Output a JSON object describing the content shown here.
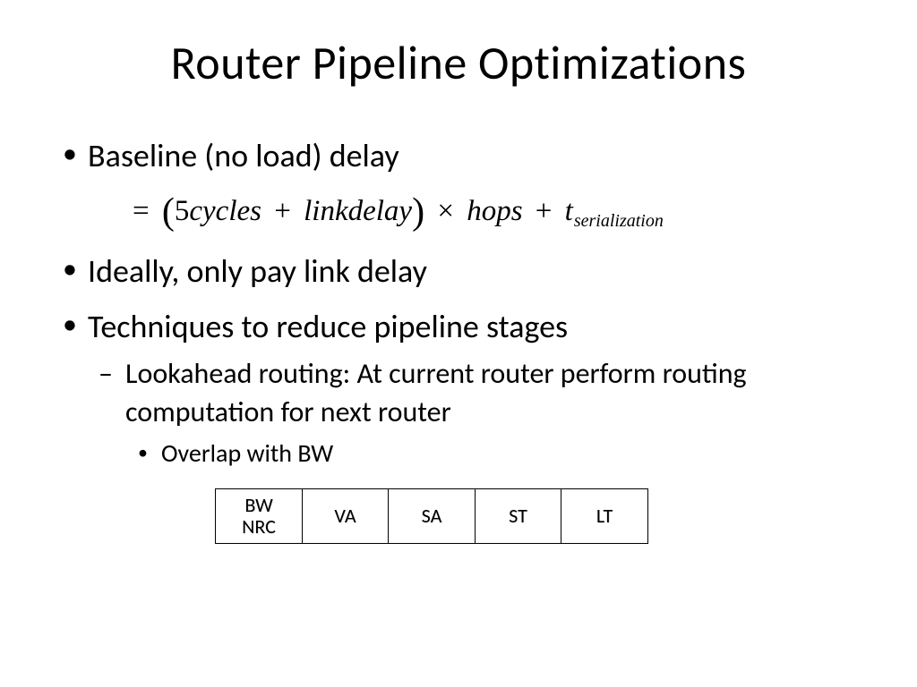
{
  "title": "Router Pipeline Optimizations",
  "bullets": {
    "b1": "Baseline (no load) delay",
    "b2": "Ideally, only pay link delay",
    "b3": "Techniques to reduce pipeline stages",
    "b3_1": "Lookahead routing: At current router perform routing computation for next router",
    "b3_1_1": "Overlap with BW"
  },
  "equation": {
    "eq": "=",
    "lparen": "(",
    "term1_num": "5",
    "term1": "cycles",
    "plus1": "+",
    "term2": "linkdelay",
    "rparen": ")",
    "times": "×",
    "term3": "hops",
    "plus2": "+",
    "term4": "t",
    "term4_sub": "serialization"
  },
  "pipeline": {
    "stages": [
      "BW\nNRC",
      "VA",
      "SA",
      "ST",
      "LT"
    ],
    "s0a": "BW",
    "s0b": "NRC",
    "s1": "VA",
    "s2": "SA",
    "s3": "ST",
    "s4": "LT"
  }
}
